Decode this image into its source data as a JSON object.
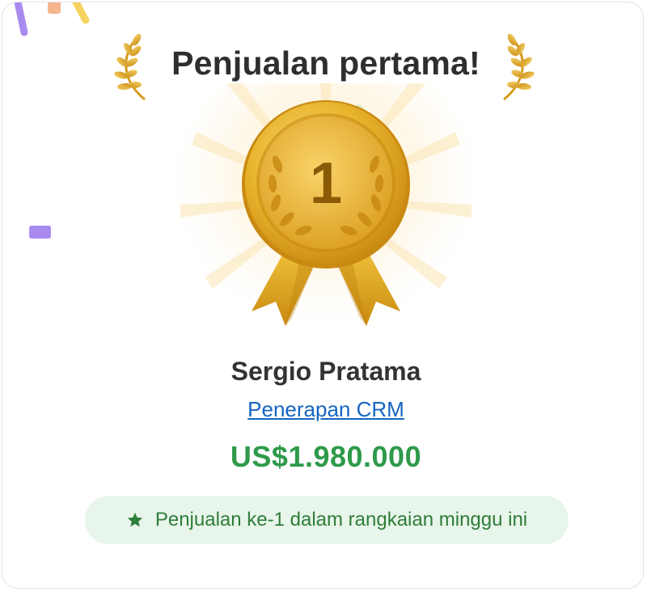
{
  "title": "Penjualan pertama!",
  "medal_rank": "1",
  "seller_name": "Sergio Pratama",
  "deal_name": "Penerapan CRM",
  "amount": "US$1.980.000",
  "streak_message": "Penjualan ke-1 dalam rangkaian minggu ini",
  "icons": {
    "wreath_left": "laurel-wreath-icon",
    "wreath_right": "laurel-wreath-icon",
    "medal": "gold-medal-icon",
    "badge": "star-icon"
  },
  "colors": {
    "title": "#2e2e2e",
    "gold": "#e0a821",
    "link": "#1565c0",
    "amount": "#2e9a4a",
    "badge_bg": "#e8f5ea",
    "badge_text": "#2e7d3a"
  }
}
